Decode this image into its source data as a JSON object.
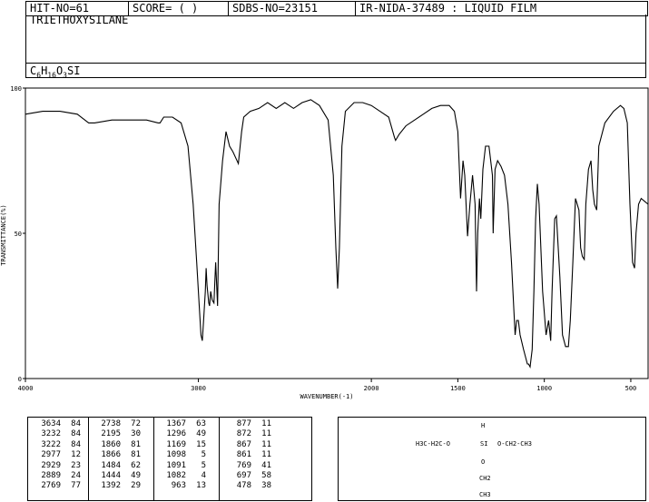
{
  "header": {
    "hit": "HIT-NO=61",
    "score": "SCORE=  (   )",
    "sdbs": "SDBS-NO=23151",
    "ir": "IR-NIDA-37489 : LIQUID FILM",
    "name": "TRIETHOXYSILANE",
    "formula_parts": [
      "C",
      "6",
      "H",
      "16",
      "O",
      "3",
      "SI"
    ]
  },
  "chart_data": {
    "type": "line",
    "xlabel": "WAVENUMBER(-1)",
    "ylabel": "TRANSMITTANCE(%)",
    "xlim": [
      4000,
      400
    ],
    "ylim": [
      0,
      100
    ],
    "x_ticks": [
      4000,
      3000,
      2000,
      1500,
      1000,
      500
    ],
    "y_ticks": [
      100,
      50,
      0
    ],
    "series": [
      {
        "points": [
          [
            4000,
            91
          ],
          [
            3900,
            92
          ],
          [
            3800,
            92
          ],
          [
            3700,
            91
          ],
          [
            3634,
            88
          ],
          [
            3600,
            88
          ],
          [
            3500,
            89
          ],
          [
            3400,
            89
          ],
          [
            3300,
            89
          ],
          [
            3232,
            88
          ],
          [
            3222,
            88
          ],
          [
            3200,
            90
          ],
          [
            3150,
            90
          ],
          [
            3100,
            88
          ],
          [
            3060,
            80
          ],
          [
            3030,
            60
          ],
          [
            3010,
            40
          ],
          [
            2995,
            25
          ],
          [
            2985,
            15
          ],
          [
            2977,
            13
          ],
          [
            2970,
            20
          ],
          [
            2960,
            30
          ],
          [
            2955,
            38
          ],
          [
            2950,
            32
          ],
          [
            2940,
            26
          ],
          [
            2935,
            25
          ],
          [
            2929,
            30
          ],
          [
            2920,
            27
          ],
          [
            2910,
            26
          ],
          [
            2900,
            40
          ],
          [
            2889,
            25
          ],
          [
            2880,
            60
          ],
          [
            2860,
            75
          ],
          [
            2840,
            85
          ],
          [
            2820,
            80
          ],
          [
            2800,
            78
          ],
          [
            2769,
            74
          ],
          [
            2750,
            85
          ],
          [
            2738,
            90
          ],
          [
            2700,
            92
          ],
          [
            2650,
            93
          ],
          [
            2600,
            95
          ],
          [
            2550,
            93
          ],
          [
            2500,
            95
          ],
          [
            2450,
            93
          ],
          [
            2400,
            95
          ],
          [
            2350,
            96
          ],
          [
            2300,
            94
          ],
          [
            2250,
            89
          ],
          [
            2220,
            70
          ],
          [
            2205,
            45
          ],
          [
            2195,
            31
          ],
          [
            2185,
            45
          ],
          [
            2170,
            80
          ],
          [
            2150,
            92
          ],
          [
            2100,
            95
          ],
          [
            2050,
            95
          ],
          [
            2000,
            94
          ],
          [
            1950,
            92
          ],
          [
            1900,
            90
          ],
          [
            1866,
            83
          ],
          [
            1860,
            82
          ],
          [
            1840,
            84
          ],
          [
            1800,
            87
          ],
          [
            1750,
            89
          ],
          [
            1700,
            91
          ],
          [
            1650,
            93
          ],
          [
            1600,
            94
          ],
          [
            1550,
            94
          ],
          [
            1520,
            92
          ],
          [
            1500,
            85
          ],
          [
            1484,
            62
          ],
          [
            1470,
            75
          ],
          [
            1460,
            70
          ],
          [
            1444,
            49
          ],
          [
            1430,
            60
          ],
          [
            1415,
            70
          ],
          [
            1400,
            60
          ],
          [
            1392,
            30
          ],
          [
            1385,
            50
          ],
          [
            1375,
            62
          ],
          [
            1367,
            55
          ],
          [
            1355,
            72
          ],
          [
            1340,
            80
          ],
          [
            1320,
            80
          ],
          [
            1300,
            70
          ],
          [
            1296,
            50
          ],
          [
            1285,
            72
          ],
          [
            1270,
            75
          ],
          [
            1250,
            73
          ],
          [
            1230,
            70
          ],
          [
            1210,
            60
          ],
          [
            1190,
            40
          ],
          [
            1169,
            15
          ],
          [
            1160,
            20
          ],
          [
            1150,
            20
          ],
          [
            1140,
            15
          ],
          [
            1120,
            10
          ],
          [
            1098,
            5
          ],
          [
            1091,
            5
          ],
          [
            1082,
            4
          ],
          [
            1070,
            10
          ],
          [
            1060,
            30
          ],
          [
            1050,
            55
          ],
          [
            1040,
            67
          ],
          [
            1030,
            60
          ],
          [
            1010,
            30
          ],
          [
            990,
            15
          ],
          [
            975,
            20
          ],
          [
            963,
            13
          ],
          [
            955,
            30
          ],
          [
            940,
            55
          ],
          [
            930,
            56
          ],
          [
            910,
            35
          ],
          [
            895,
            15
          ],
          [
            877,
            11
          ],
          [
            872,
            11
          ],
          [
            867,
            11
          ],
          [
            861,
            11
          ],
          [
            850,
            20
          ],
          [
            835,
            40
          ],
          [
            820,
            62
          ],
          [
            800,
            58
          ],
          [
            790,
            45
          ],
          [
            780,
            42
          ],
          [
            769,
            41
          ],
          [
            760,
            60
          ],
          [
            745,
            72
          ],
          [
            730,
            75
          ],
          [
            720,
            65
          ],
          [
            710,
            60
          ],
          [
            697,
            58
          ],
          [
            685,
            80
          ],
          [
            650,
            88
          ],
          [
            600,
            92
          ],
          [
            560,
            94
          ],
          [
            540,
            93
          ],
          [
            520,
            88
          ],
          [
            505,
            60
          ],
          [
            490,
            40
          ],
          [
            478,
            38
          ],
          [
            470,
            50
          ],
          [
            455,
            60
          ],
          [
            440,
            62
          ],
          [
            420,
            61
          ],
          [
            400,
            60
          ]
        ]
      }
    ],
    "grid": false
  },
  "peak_table": [
    [
      [
        "3634",
        "84"
      ],
      [
        "3232",
        "84"
      ],
      [
        "3222",
        "84"
      ],
      [
        "2977",
        "12"
      ],
      [
        "2929",
        "23"
      ],
      [
        "2889",
        "24"
      ],
      [
        "2769",
        "77"
      ]
    ],
    [
      [
        "2738",
        "72"
      ],
      [
        "2195",
        "30"
      ],
      [
        "1860",
        "81"
      ],
      [
        "1866",
        "81"
      ],
      [
        "1484",
        "62"
      ],
      [
        "1444",
        "49"
      ],
      [
        "1392",
        "29"
      ]
    ],
    [
      [
        "1367",
        "63"
      ],
      [
        "1296",
        "49"
      ],
      [
        "1169",
        "15"
      ],
      [
        "1098",
        "5"
      ],
      [
        "1091",
        "5"
      ],
      [
        "1082",
        "4"
      ],
      [
        "963",
        "13"
      ]
    ],
    [
      [
        "877",
        "11"
      ],
      [
        "872",
        "11"
      ],
      [
        "867",
        "11"
      ],
      [
        "861",
        "11"
      ],
      [
        "769",
        "41"
      ],
      [
        "697",
        "58"
      ],
      [
        "478",
        "38"
      ]
    ]
  ],
  "structure": {
    "h": "H",
    "left": "H3C-H2C-O",
    "si": "SI",
    "right": "O-CH2-CH3",
    "o": "O",
    "ch2": "CH2",
    "ch3": "CH3"
  }
}
